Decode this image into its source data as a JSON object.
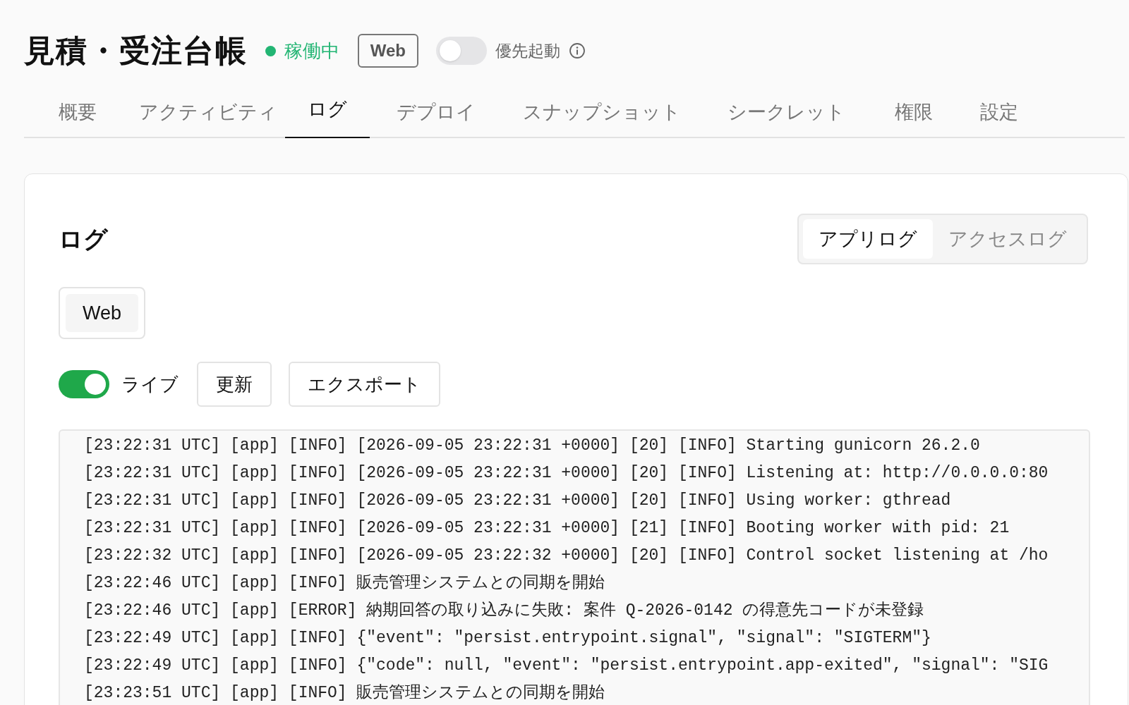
{
  "app": {
    "title": "見積・受注台帳",
    "status": {
      "label": "稼働中",
      "color": "#22b573"
    },
    "badge": "Web",
    "priority_boot": {
      "label": "優先起動",
      "on": false
    }
  },
  "tabs": [
    {
      "label": "概要",
      "selected": false
    },
    {
      "label": "アクティビティ",
      "selected": false
    },
    {
      "label": "ログ",
      "selected": true
    },
    {
      "label": "デプロイ",
      "selected": false
    },
    {
      "label": "スナップショット",
      "selected": false
    },
    {
      "label": "シークレット",
      "selected": false
    },
    {
      "label": "権限",
      "selected": false
    },
    {
      "label": "設定",
      "selected": false
    }
  ],
  "logs_panel": {
    "title": "ログ",
    "log_types": [
      {
        "label": "アプリログ",
        "selected": true
      },
      {
        "label": "アクセスログ",
        "selected": false
      }
    ],
    "services": [
      {
        "label": "Web",
        "selected": true
      }
    ],
    "live": {
      "label": "ライブ",
      "on": true
    },
    "buttons": [
      "更新",
      "エクスポート"
    ],
    "lines": [
      "[23:22:31 UTC] [app] [INFO] [2026-09-05 23:22:31 +0000] [20] [INFO] Starting gunicorn 26.2.0",
      "[23:22:31 UTC] [app] [INFO] [2026-09-05 23:22:31 +0000] [20] [INFO] Listening at: http://0.0.0.0:80",
      "[23:22:31 UTC] [app] [INFO] [2026-09-05 23:22:31 +0000] [20] [INFO] Using worker: gthread",
      "[23:22:31 UTC] [app] [INFO] [2026-09-05 23:22:31 +0000] [21] [INFO] Booting worker with pid: 21",
      "[23:22:32 UTC] [app] [INFO] [2026-09-05 23:22:32 +0000] [20] [INFO] Control socket listening at /ho",
      "[23:22:46 UTC] [app] [INFO] 販売管理システムとの同期を開始",
      "[23:22:46 UTC] [app] [ERROR] 納期回答の取り込みに失敗: 案件 Q-2026-0142 の得意先コードが未登録",
      "[23:22:49 UTC] [app] [INFO] {\"event\": \"persist.entrypoint.signal\", \"signal\": \"SIGTERM\"}",
      "[23:22:49 UTC] [app] [INFO] {\"code\": null, \"event\": \"persist.entrypoint.app-exited\", \"signal\": \"SIG",
      "[23:23:51 UTC] [app] [INFO] 販売管理システムとの同期を開始"
    ]
  }
}
